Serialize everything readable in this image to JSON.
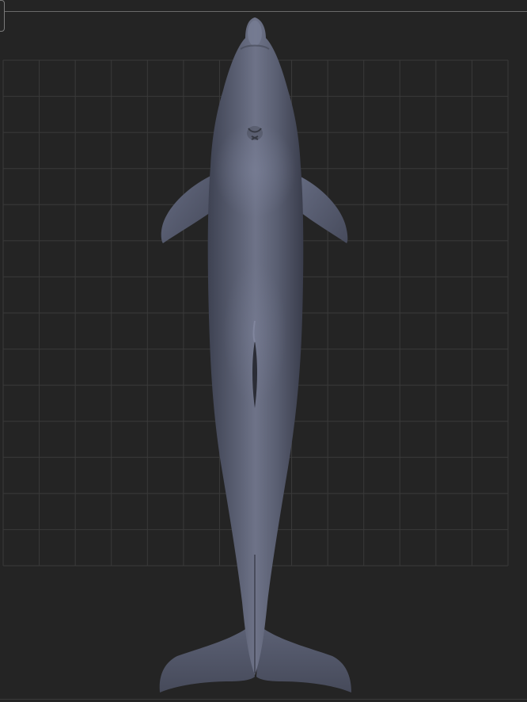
{
  "viewport": {
    "background": "#242424",
    "grid_color": "#3a3a3a",
    "grid_on": true
  },
  "model": {
    "name": "dolphin",
    "view": "bottom",
    "base_color": "#5a5f72",
    "highlight_color": "#7c829a",
    "shadow_color": "#3c4050"
  }
}
